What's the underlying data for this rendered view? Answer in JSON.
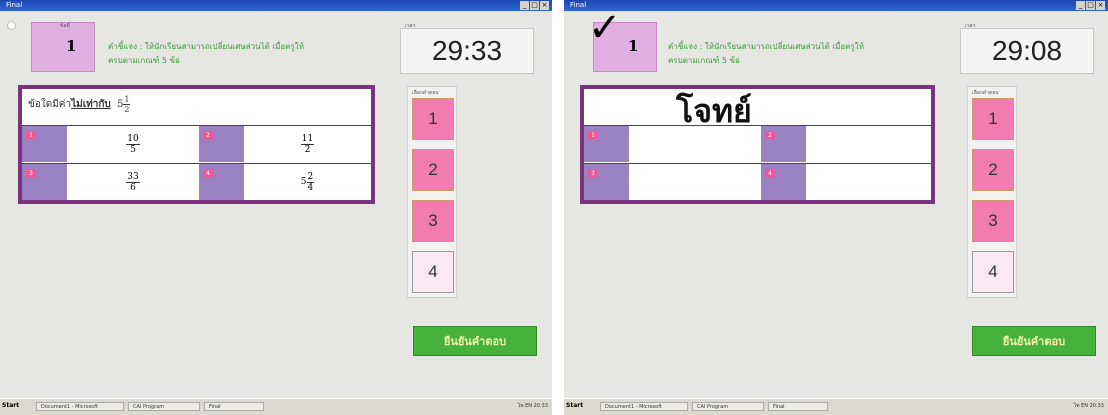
{
  "left": {
    "title": "Final",
    "window_buttons": [
      "_",
      "□",
      "×"
    ],
    "number_label": "ข้อที่",
    "number": "1",
    "instruction_line1": "คำชี้แจง : ให้นักเรียนสามารถเปลี่ยนเศษส่วนได้ เมื่อครูให้",
    "instruction_line2": "ครบตามเกณฑ์ 5 ข้อ",
    "timer_label": "เวลา",
    "timer": "29:33",
    "question_prefix": "ข้อใดมีค่า",
    "question_emph": "ไม่เท่ากับ",
    "question_whole": "5",
    "question_num": "1",
    "question_den": "2",
    "options": [
      {
        "label": "1",
        "whole": "",
        "num": "10",
        "den": "5"
      },
      {
        "label": "2",
        "whole": "",
        "num": "11",
        "den": "2"
      },
      {
        "label": "3",
        "whole": "",
        "num": "33",
        "den": "6"
      },
      {
        "label": "4",
        "whole": "5",
        "num": "2",
        "den": "4"
      }
    ],
    "answer_label": "เลือกคำตอบ",
    "answers": [
      "1",
      "2",
      "3",
      "4"
    ],
    "confirm_label": "ยืนยันคำตอบ",
    "taskbar": {
      "start": "Start",
      "items": [
        "Document1 - Microsoft",
        "CAI Program",
        "Final"
      ],
      "tray": "ไท EN 20:33"
    }
  },
  "right": {
    "title": "Final",
    "window_buttons": [
      "_",
      "□",
      "×"
    ],
    "checkmark": "✓",
    "number": "1",
    "instruction_line1": "คำชี้แจง : ให้นักเรียนสามารถเปลี่ยนเศษส่วนได้ เมื่อครูให้",
    "instruction_line2": "ครบตามเกณฑ์ 5 ข้อ",
    "timer_label": "เวลา",
    "timer": "29:08",
    "overlay_word": "โจทย์",
    "option_labels": [
      "1",
      "2",
      "3",
      "4"
    ],
    "answer_label": "เลือกคำตอบ",
    "answers": [
      "1",
      "2",
      "3",
      "4"
    ],
    "confirm_label": "ยืนยันคำตอบ",
    "taskbar": {
      "start": "Start",
      "items": [
        "Document1 - Microsoft",
        "CAI Program",
        "Final"
      ],
      "tray": "ไท EN 20:33"
    }
  }
}
